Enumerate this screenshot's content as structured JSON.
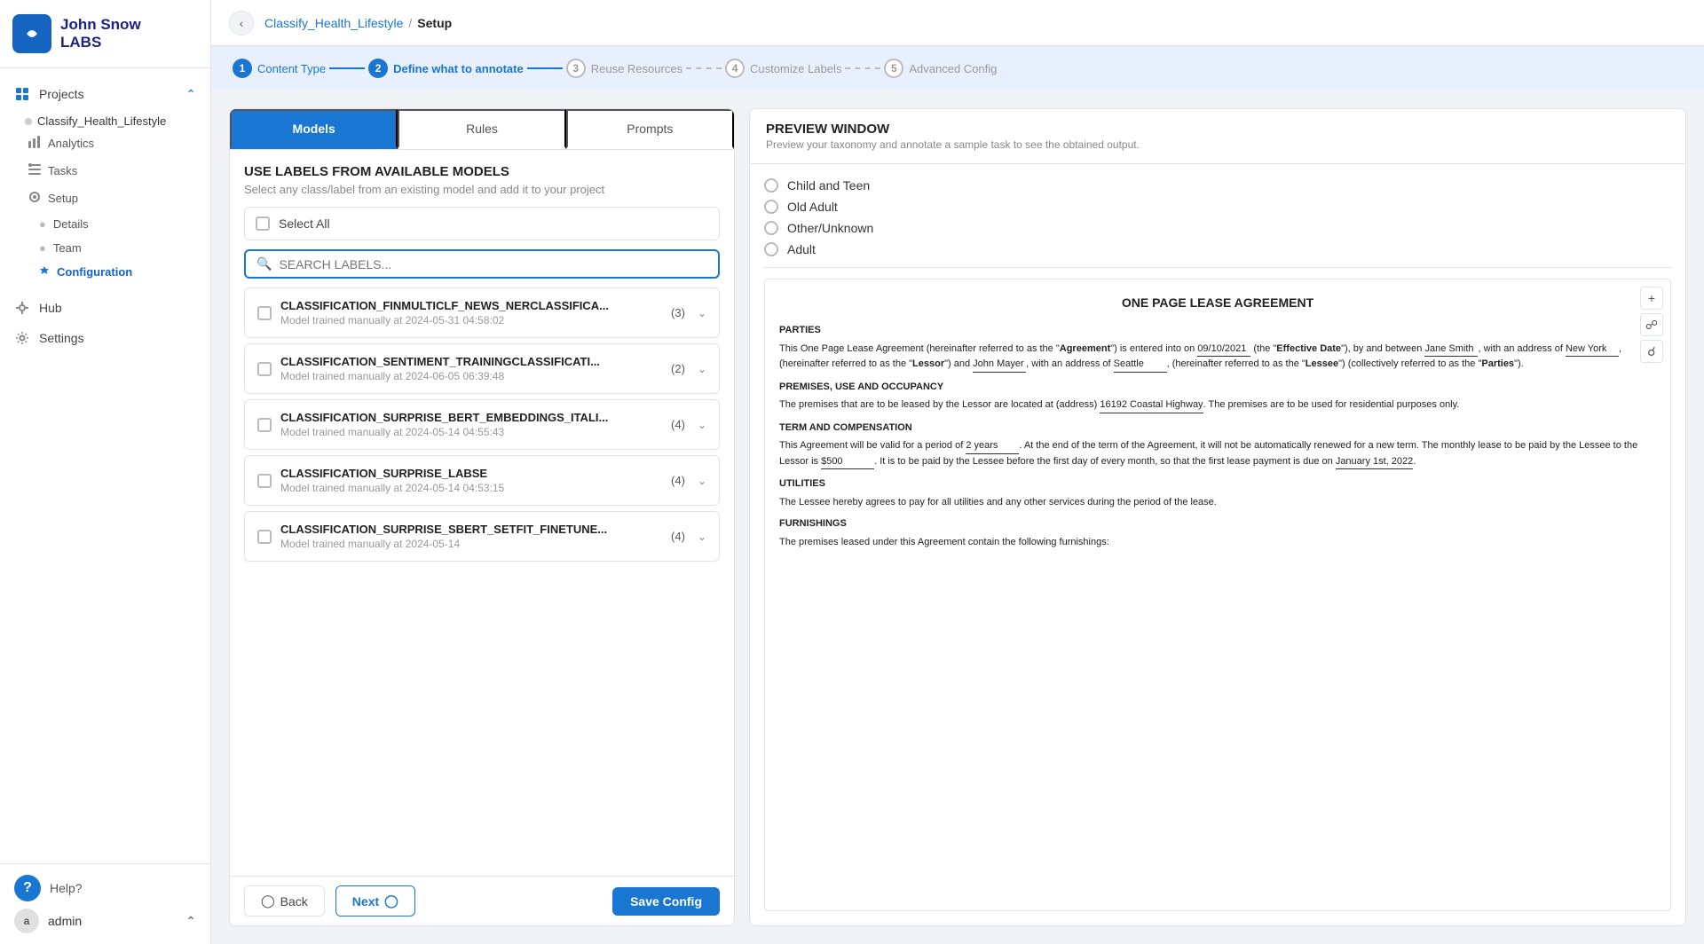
{
  "sidebar": {
    "logo_line1": "John Snow",
    "logo_line2": "LABS",
    "nav_projects_label": "Projects",
    "project_name": "Classify_Health_Lifestyle",
    "nav_items": [
      {
        "id": "analytics",
        "label": "Analytics",
        "icon": "chart-icon"
      },
      {
        "id": "tasks",
        "label": "Tasks",
        "icon": "tasks-icon"
      },
      {
        "id": "setup",
        "label": "Setup",
        "icon": "setup-icon"
      }
    ],
    "sub_items": [
      {
        "id": "details",
        "label": "Details"
      },
      {
        "id": "team",
        "label": "Team"
      },
      {
        "id": "configuration",
        "label": "Configuration",
        "active": true
      }
    ],
    "hub_label": "Hub",
    "settings_label": "Settings",
    "help_label": "Help?",
    "admin_label": "admin",
    "admin_initial": "a"
  },
  "breadcrumb": {
    "project": "Classify_Health_Lifestyle",
    "separator": "/",
    "current": "Setup"
  },
  "steps": [
    {
      "num": "1",
      "label": "Content Type",
      "state": "done"
    },
    {
      "num": "2",
      "label": "Define what to annotate",
      "state": "active"
    },
    {
      "num": "3",
      "label": "Reuse Resources",
      "state": "inactive"
    },
    {
      "num": "4",
      "label": "Customize Labels",
      "state": "inactive"
    },
    {
      "num": "5",
      "label": "Advanced Config",
      "state": "inactive"
    }
  ],
  "tabs": [
    {
      "id": "models",
      "label": "Models",
      "active": true
    },
    {
      "id": "rules",
      "label": "Rules"
    },
    {
      "id": "prompts",
      "label": "Prompts"
    }
  ],
  "panel": {
    "title": "USE LABELS FROM AVAILABLE MODELS",
    "subtitle": "Select any class/label from an existing model and add it to your project",
    "select_all_label": "Select All",
    "search_placeholder": "SEARCH LABELS...",
    "models": [
      {
        "name": "CLASSIFICATION_FINMULTICLF_NEWS_NERCLASSIFICA...",
        "date": "Model trained manually at 2024-05-31 04:58:02",
        "count": "(3)"
      },
      {
        "name": "CLASSIFICATION_SENTIMENT_TRAININGCLASSIFICATI...",
        "date": "Model trained manually at 2024-06-05 06:39:48",
        "count": "(2)"
      },
      {
        "name": "CLASSIFICATION_SURPRISE_BERT_EMBEDDINGS_ITALI...",
        "date": "Model trained manually at 2024-05-14 04:55:43",
        "count": "(4)"
      },
      {
        "name": "CLASSIFICATION_SURPRISE_LABSE",
        "date": "Model trained manually at 2024-05-14 04:53:15",
        "count": "(4)"
      },
      {
        "name": "CLASSIFICATION_SURPRISE_SBERT_SETFIT_FINETUNE...",
        "date": "Model trained manually at 2024-05-14",
        "count": "(4)"
      }
    ]
  },
  "buttons": {
    "back": "Back",
    "next": "Next",
    "save": "Save Config"
  },
  "preview": {
    "title": "PREVIEW WINDOW",
    "subtitle": "Preview your taxonomy and annotate a sample task to see the obtained output.",
    "radio_options": [
      "Child and Teen",
      "Old Adult",
      "Other/Unknown",
      "Adult"
    ],
    "doc_title": "ONE PAGE LEASE AGREEMENT",
    "doc_sections": [
      {
        "heading": "PARTIES",
        "text": "This One Page Lease Agreement (hereinafter referred to as the \"Agreement\") is entered into on 09/10/2021 (the \"Effective Date\"), by and between Jane Smith, with an address of New York, (hereinafter referred to as the \"Lessor\") and John Mayer, with an address of Seattle, (hereinafter referred to as the \"Lessee\") (collectively referred to as the \"Parties\")."
      },
      {
        "heading": "PREMISES, USE AND OCCUPANCY",
        "text": "The premises that are to be leased by the Lessor are located at (address) 16192 Coastal Highway. The premises are to be used for residential purposes only."
      },
      {
        "heading": "TERM AND COMPENSATION",
        "text": "This Agreement will be valid for a period of 2 years. At the end of the term of the Agreement, it will not be automatically renewed for a new term. The monthly lease to be paid by the Lessee to the Lessor is $500. It is to be paid by the Lessee before the first day of every month, so that the first lease payment is due on January 1st, 2022."
      },
      {
        "heading": "UTILITIES",
        "text": "The Lessee hereby agrees to pay for all utilities and any other services during the period of the lease."
      },
      {
        "heading": "FURNISHINGS",
        "text": "The premises leased under this Agreement contain the following furnishings:"
      }
    ]
  }
}
